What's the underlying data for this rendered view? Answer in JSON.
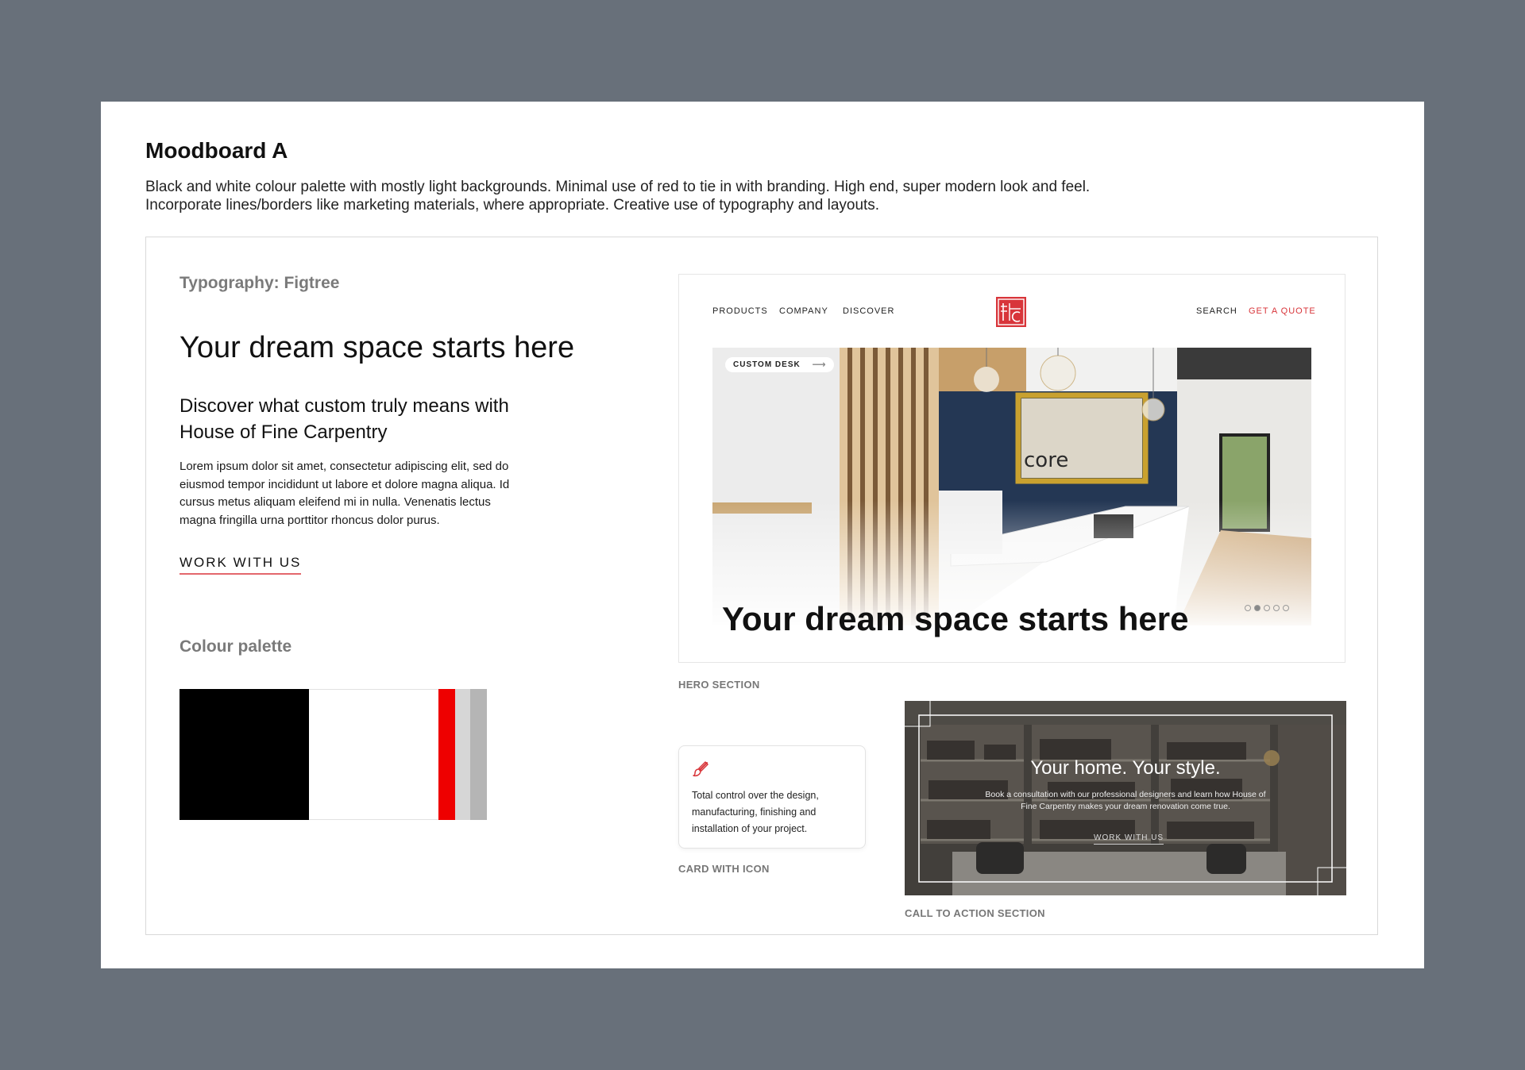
{
  "board": {
    "title": "Moodboard A",
    "description": "Black and white colour palette with mostly light backgrounds. Minimal use of red to tie in with branding. High end, super modern look and feel. Incorporate lines/borders like marketing materials, where appropriate. Creative use of typography and layouts."
  },
  "typography": {
    "label": "Typography: Figtree",
    "h1": "Your dream space starts here",
    "h2": "Discover what custom truly means with House of Fine Carpentry",
    "body": "Lorem ipsum dolor sit amet, consectetur adipiscing elit, sed do eiusmod tempor incididunt ut labore et dolore magna aliqua. Id cursus metus aliquam eleifend mi in nulla. Venenatis lectus magna fringilla urna porttitor rhoncus dolor purus.",
    "link": "WORK WITH US"
  },
  "palette": {
    "label": "Colour palette",
    "swatches": [
      {
        "name": "black",
        "color": "#000000",
        "share": 0.42
      },
      {
        "name": "white",
        "color": "#ffffff",
        "share": 0.42
      },
      {
        "name": "red",
        "color": "#ee0000",
        "share": 0.055
      },
      {
        "name": "light-grey",
        "color": "#d6d6d6",
        "share": 0.05
      },
      {
        "name": "grey",
        "color": "#b5b5b5",
        "share": 0.055
      }
    ]
  },
  "hero": {
    "nav": {
      "products": "PRODUCTS",
      "company": "COMPANY",
      "discover": "DISCOVER",
      "search": "SEARCH",
      "quote": "GET A QUOTE"
    },
    "pill": "CUSTOM DESK",
    "sign": "core",
    "headline": "Your dream space starts here",
    "slides": 5,
    "active_slide": 2,
    "caption": "HERO SECTION"
  },
  "card": {
    "icon": "paintbrush-icon",
    "text": "Total control over the design, manufacturing, finishing and installation of your project.",
    "caption": "CARD WITH ICON"
  },
  "cta": {
    "headline": "Your home. Your style.",
    "body": "Book a consultation with our professional designers and learn how House of Fine Carpentry makes your dream renovation come true.",
    "link": "WORK WITH US",
    "caption": "CALL TO ACTION SECTION"
  },
  "colors": {
    "brand_red": "#d8353a",
    "backdrop": "#68707a"
  }
}
